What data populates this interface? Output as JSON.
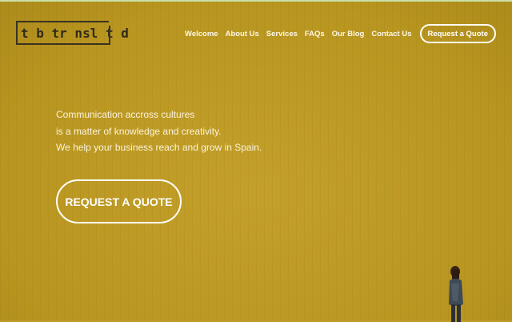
{
  "logo": {
    "text": "t b tr nsl t d"
  },
  "nav": {
    "items": [
      {
        "label": "Welcome"
      },
      {
        "label": "About Us"
      },
      {
        "label": "Services"
      },
      {
        "label": "FAQs"
      },
      {
        "label": "Our Blog"
      },
      {
        "label": "Contact Us"
      }
    ],
    "quote_label": "Request a Quote"
  },
  "hero": {
    "lines": [
      "Communication accross cultures",
      "is a matter of knowledge and creativity.",
      "We help your business reach and grow in Spain."
    ],
    "cta_label": "REQUEST A QUOTE"
  },
  "colors": {
    "background": "#c09c26",
    "text": "#ffffff"
  }
}
